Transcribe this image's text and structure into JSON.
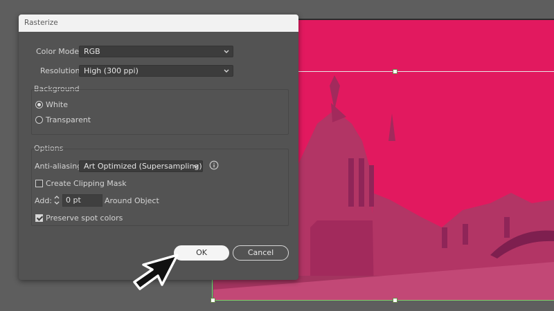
{
  "dialog": {
    "title": "Rasterize",
    "color_model": {
      "label": "Color Model:",
      "value": "RGB"
    },
    "resolution": {
      "label": "Resolution:",
      "value": "High (300 ppi)"
    },
    "background": {
      "title": "Background",
      "options": [
        {
          "label": "White",
          "selected": true
        },
        {
          "label": "Transparent",
          "selected": false
        }
      ]
    },
    "options": {
      "title": "Options",
      "anti_aliasing": {
        "label": "Anti-aliasing:",
        "value": "Art Optimized (Supersampling)"
      },
      "clipping_mask": {
        "label": "Create Clipping Mask",
        "checked": false
      },
      "add": {
        "label": "Add:",
        "value": "0 pt",
        "suffix": "Around Object"
      },
      "preserve_spot": {
        "label": "Preserve spot colors",
        "checked": true
      }
    },
    "buttons": {
      "ok": "OK",
      "cancel": "Cancel"
    }
  },
  "colors": {
    "dialog_bg": "#535353",
    "image_tint": "#e2195f",
    "canvas_bg": "#5e5e5e"
  },
  "icons": [
    "chevron-down-icon",
    "info-icon",
    "stepper-icon",
    "arrow-cursor-icon"
  ]
}
